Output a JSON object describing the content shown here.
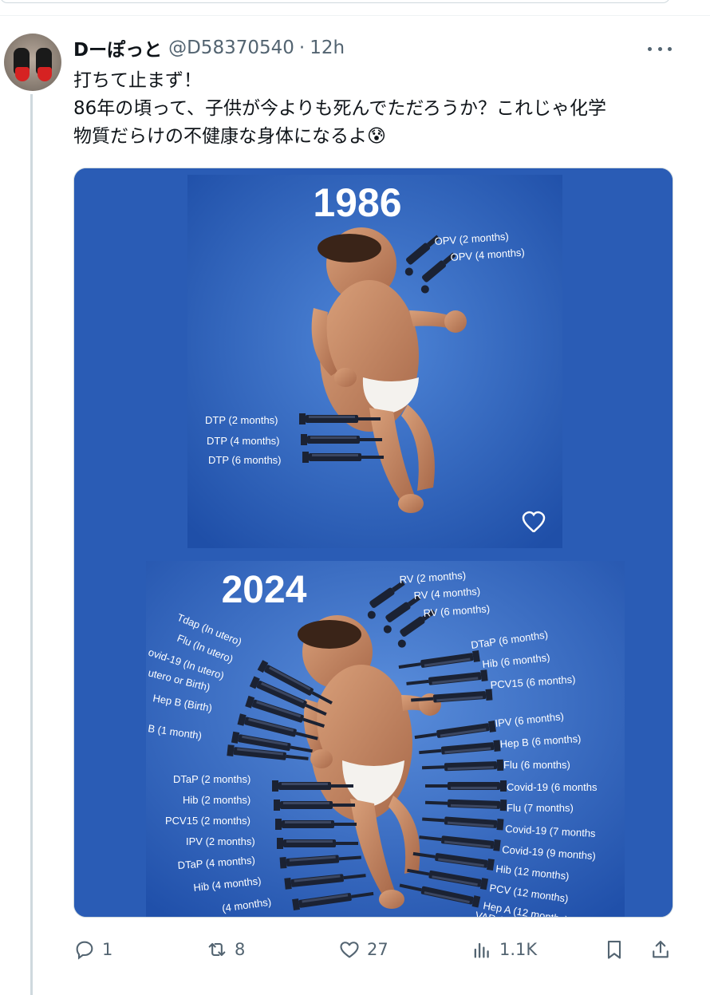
{
  "tweet": {
    "display_name": "Dーぽっと",
    "handle": "@D58370540",
    "separator": "·",
    "time": "12h",
    "lines": [
      "打ちて止まず！",
      "86年の頃って、子供が今よりも死んでただろうか？これじゃ化学",
      "物質だらけの不健康な身体になるよ😰"
    ]
  },
  "media": {
    "year_top": "1986",
    "year_bottom": "2024",
    "labels_1986_oral": [
      "OPV (2 months)",
      "OPV (4 months)"
    ],
    "labels_1986_shots": [
      "DTP (2 months)",
      "DTP (4 months)",
      "DTP (6 months)"
    ],
    "labels_2024_oral": [
      "RV (2 months)",
      "RV (4 months)",
      "RV (6 months)"
    ],
    "labels_2024_left_top": [
      "Tdap (In utero)",
      "Flu (In utero)",
      "ovid-19 (In utero)",
      "utero or Birth)",
      "Hep B (Birth)",
      "B (1 month)"
    ],
    "labels_2024_left_bottom": [
      "DTaP (2 months)",
      "Hib (2 months)",
      "PCV15 (2 months)",
      "IPV (2 months)",
      "DTaP (4 months)",
      "Hib (4 months)",
      "(4 months)"
    ],
    "labels_2024_right": [
      "DTaP (6 months)",
      "Hib (6 months)",
      "PCV15 (6 months)",
      "IPV (6 months)",
      "Hep B (6 months)",
      "Flu (6 months)",
      "Covid-19 (6 months",
      "Flu (7 months)",
      "Covid-19 (7 months",
      "Covid-19 (9 months)",
      "Hib (12 months)",
      "PCV (12 months)",
      "Hep A (12 months)",
      "VAR (12 m"
    ]
  },
  "actions": {
    "replies": "1",
    "reposts": "8",
    "likes": "27",
    "views": "1.1K"
  },
  "colors": {
    "accent_text": "#0f1419",
    "secondary_text": "#536471",
    "media_blue": "#2a5cb5"
  },
  "icons": [
    "more-icon",
    "heart-icon",
    "reply-icon",
    "repost-icon",
    "like-icon",
    "views-icon",
    "bookmark-icon",
    "share-icon"
  ]
}
